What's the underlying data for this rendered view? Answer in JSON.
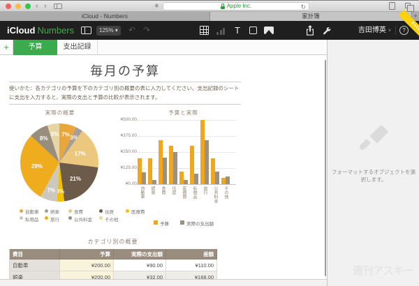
{
  "browser": {
    "tabs": [
      {
        "label": "iCloud - Numbers",
        "active": false
      },
      {
        "label": "家計簿",
        "active": true
      }
    ],
    "address": "Apple Inc.",
    "glyphs": {
      "back": "‹",
      "forward": "›",
      "reload": "↻",
      "new_tab": "+",
      "extension": "✱"
    }
  },
  "app_toolbar": {
    "brand_icloud": "iCloud",
    "brand_numbers": "Numbers",
    "zoom_value": "125% ▾",
    "glyphs": {
      "undo": "↶",
      "redo": "↷",
      "text_tool": "T"
    },
    "user_name": "吉田博英",
    "user_caret": "˅",
    "help": "?",
    "beta": "beta"
  },
  "sheet_tabs": {
    "add": "+",
    "items": [
      {
        "label": "予算",
        "active": true
      },
      {
        "label": "支出記録",
        "active": false
      }
    ]
  },
  "document": {
    "title": "毎月の予算",
    "instructions": "使いかた：各カテゴリの予算を下のカテゴリ別の概要の表に入力してください。支出記録のシートに支出を入力すると、実際の支出と予算の比較が表示されます。"
  },
  "chart_data": [
    {
      "type": "pie",
      "title": "実際の概要",
      "labels": [
        "自動車",
        "娯楽",
        "食費",
        "住居",
        "医療費",
        "私物品",
        "旅行",
        "公共料金",
        "その他"
      ],
      "values_percent": [
        7,
        3,
        17,
        21,
        3,
        7,
        29,
        8,
        5
      ],
      "colors": [
        "#e9a63b",
        "#a89e92",
        "#ebc87d",
        "#6c5b49",
        "#f2c103",
        "#cdc8bf",
        "#efad1e",
        "#988e7e",
        "#e8d5a4"
      ],
      "legend_position": "bottom"
    },
    {
      "type": "bar",
      "title": "予算と実際",
      "categories": [
        "自動車",
        "娯楽",
        "食費",
        "住居",
        "医療費",
        "私物品",
        "旅行",
        "公共料金",
        "その他"
      ],
      "series": [
        {
          "name": "予算",
          "color": "#f0a71e",
          "values": [
            200,
            200,
            340,
            300,
            100,
            300,
            500,
            200,
            50
          ]
        },
        {
          "name": "実際の支出額",
          "color": "#9c9181",
          "values": [
            90,
            32,
            205,
            250,
            35,
            80,
            340,
            100,
            60
          ]
        }
      ],
      "ylim": [
        0,
        500
      ],
      "yticks": [
        500,
        375,
        250,
        125,
        0
      ],
      "ytick_labels": [
        "¥500.00",
        "¥375.00",
        "¥250.00",
        "¥125.00",
        "¥0.00"
      ],
      "grid": true,
      "legend_position": "bottom"
    }
  ],
  "summary_table": {
    "title": "カテゴリ別の概要",
    "headers": [
      "費目",
      "予算",
      "実際の支出額",
      "差額"
    ],
    "rows": [
      [
        "自動車",
        "¥200.00",
        "¥90.00",
        "¥110.00"
      ],
      [
        "娯楽",
        "¥200.00",
        "¥32.00",
        "¥168.00"
      ]
    ]
  },
  "format_panel": {
    "placeholder": "フォーマットするオブジェクトを選択します。"
  },
  "watermark": "週刊アスキー"
}
